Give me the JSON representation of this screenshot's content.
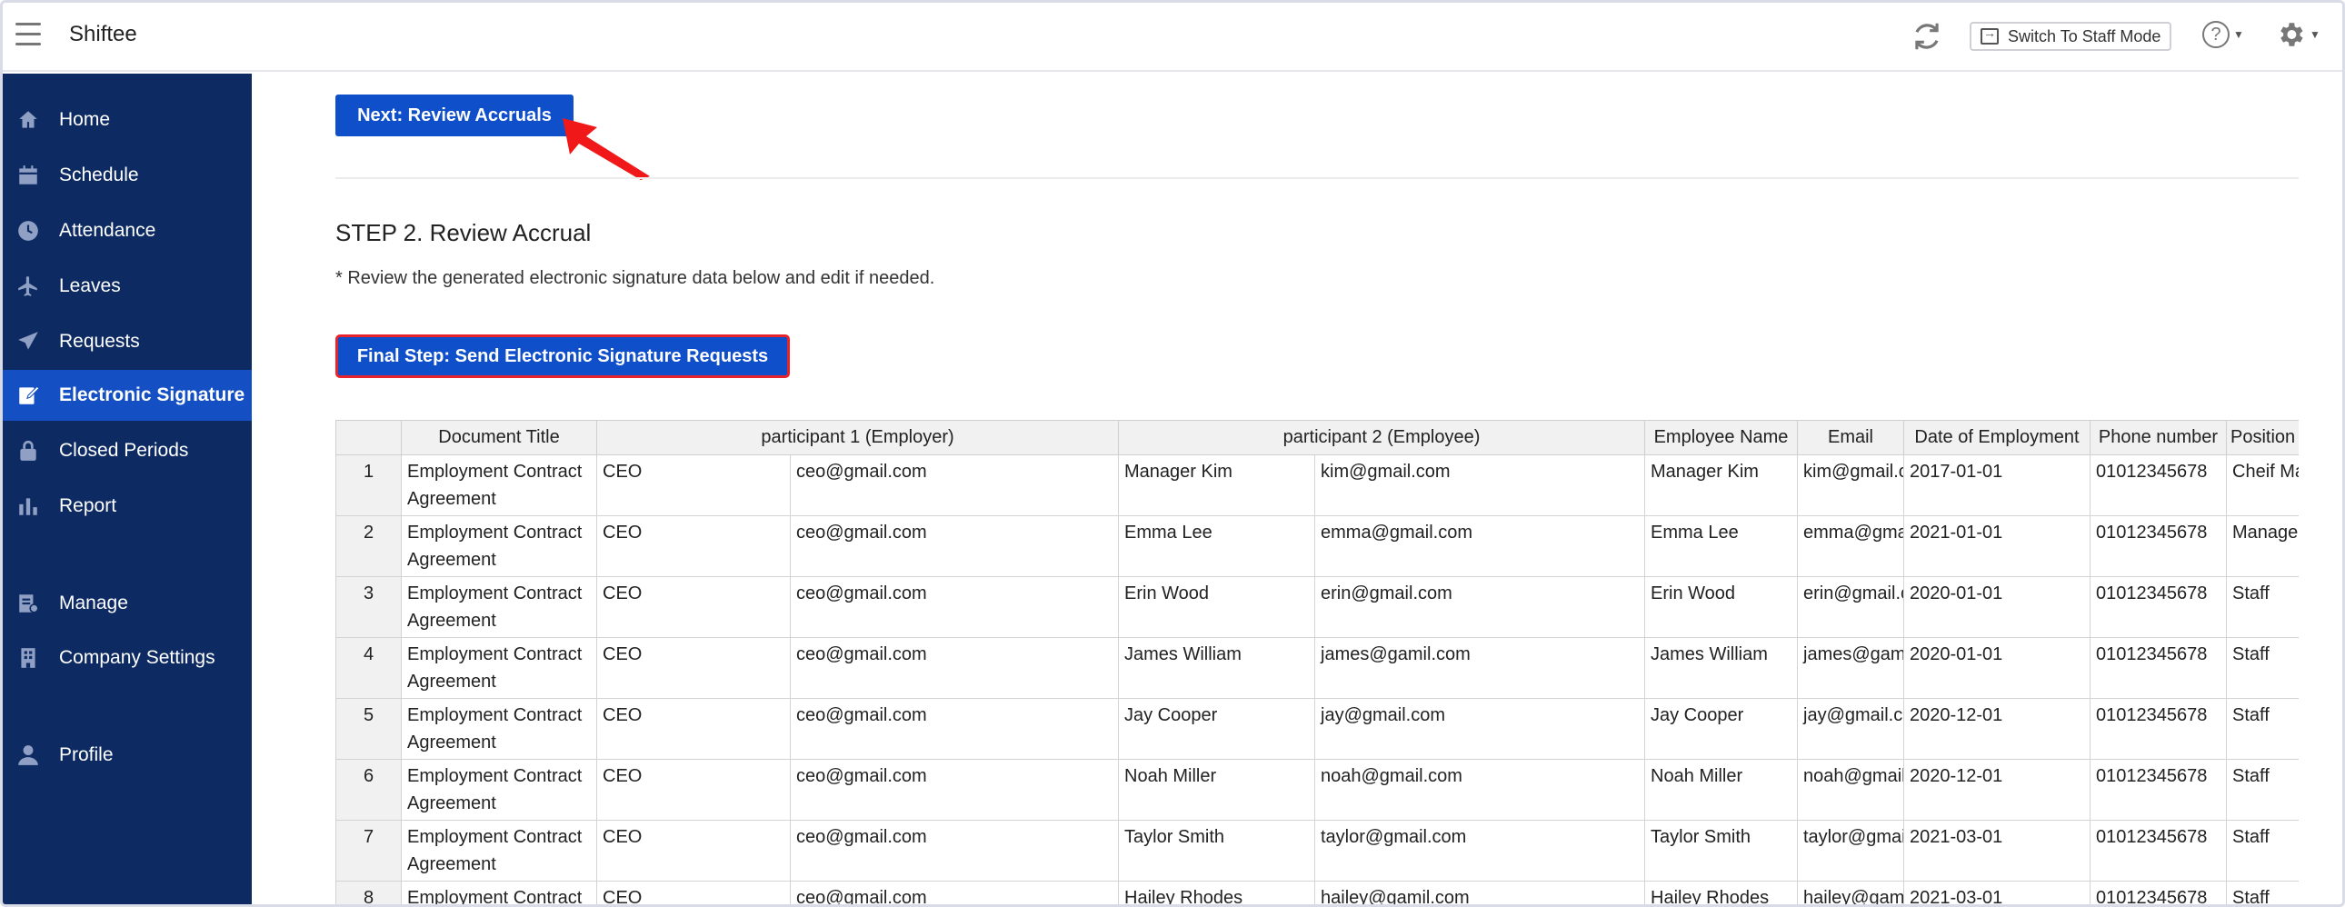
{
  "app": {
    "title": "Shiftee",
    "switch_mode_label": "Switch To Staff Mode",
    "help_symbol": "?"
  },
  "sidebar": {
    "items": [
      {
        "label": "Home",
        "icon": "home-icon"
      },
      {
        "label": "Schedule",
        "icon": "calendar-icon"
      },
      {
        "label": "Attendance",
        "icon": "clock-icon"
      },
      {
        "label": "Leaves",
        "icon": "airplane-icon"
      },
      {
        "label": "Requests",
        "icon": "paper-plane-icon"
      },
      {
        "label": "Electronic Signature",
        "icon": "signature-icon",
        "active": true
      },
      {
        "label": "Closed Periods",
        "icon": "lock-icon"
      },
      {
        "label": "Report",
        "icon": "bar-chart-icon"
      },
      {
        "label": "Manage",
        "icon": "manage-icon"
      },
      {
        "label": "Company Settings",
        "icon": "building-icon"
      },
      {
        "label": "Profile",
        "icon": "user-icon"
      }
    ]
  },
  "main": {
    "next_button": "Next: Review Accruals",
    "step_title": "STEP 2. Review Accrual",
    "hint": "* Review the generated electronic signature data below and edit if needed.",
    "final_button": "Final Step: Send Electronic Signature Requests",
    "colors": {
      "primary": "#0f4fc9",
      "sidebar": "#0d2b62",
      "active": "#1450c4",
      "highlight": "#e8232b"
    }
  },
  "table": {
    "headers": [
      "Document Title",
      "participant 1 (Employer)",
      "participant 2 (Employee)",
      "Employee Name",
      "Email",
      "Date of Employment",
      "Phone number",
      "Position"
    ],
    "rows": [
      [
        "1",
        "Employment Contract Agreement",
        "CEO",
        "ceo@gmail.com",
        "Manager Kim",
        "kim@gmail.com",
        "Manager Kim",
        "kim@gmail.com",
        "2017-01-01",
        "01012345678",
        "Cheif Manager"
      ],
      [
        "2",
        "Employment Contract Agreement",
        "CEO",
        "ceo@gmail.com",
        "Emma Lee",
        "emma@gmail.com",
        "Emma Lee",
        "emma@gmail.com",
        "2021-01-01",
        "01012345678",
        "Manager"
      ],
      [
        "3",
        "Employment Contract Agreement",
        "CEO",
        "ceo@gmail.com",
        "Erin Wood",
        "erin@gmail.com",
        "Erin Wood",
        "erin@gmail.com",
        "2020-01-01",
        "01012345678",
        "Staff"
      ],
      [
        "4",
        "Employment Contract Agreement",
        "CEO",
        "ceo@gmail.com",
        "James William",
        "james@gamil.com",
        "James William",
        "james@gamil.com",
        "2020-01-01",
        "01012345678",
        "Staff"
      ],
      [
        "5",
        "Employment Contract Agreement",
        "CEO",
        "ceo@gmail.com",
        "Jay Cooper",
        "jay@gmail.com",
        "Jay Cooper",
        "jay@gmail.com",
        "2020-12-01",
        "01012345678",
        "Staff"
      ],
      [
        "6",
        "Employment Contract Agreement",
        "CEO",
        "ceo@gmail.com",
        "Noah Miller",
        "noah@gmail.com",
        "Noah Miller",
        "noah@gmail.com",
        "2020-12-01",
        "01012345678",
        "Staff"
      ],
      [
        "7",
        "Employment Contract Agreement",
        "CEO",
        "ceo@gmail.com",
        "Taylor Smith",
        "taylor@gmail.com",
        "Taylor Smith",
        "taylor@gmail.com",
        "2021-03-01",
        "01012345678",
        "Staff"
      ],
      [
        "8",
        "Employment Contract Agreement",
        "CEO",
        "ceo@gmail.com",
        "Hailey Rhodes",
        "hailey@gamil.com",
        "Hailey Rhodes",
        "hailey@gamil.com",
        "2021-03-01",
        "01012345678",
        "Staff"
      ]
    ]
  }
}
